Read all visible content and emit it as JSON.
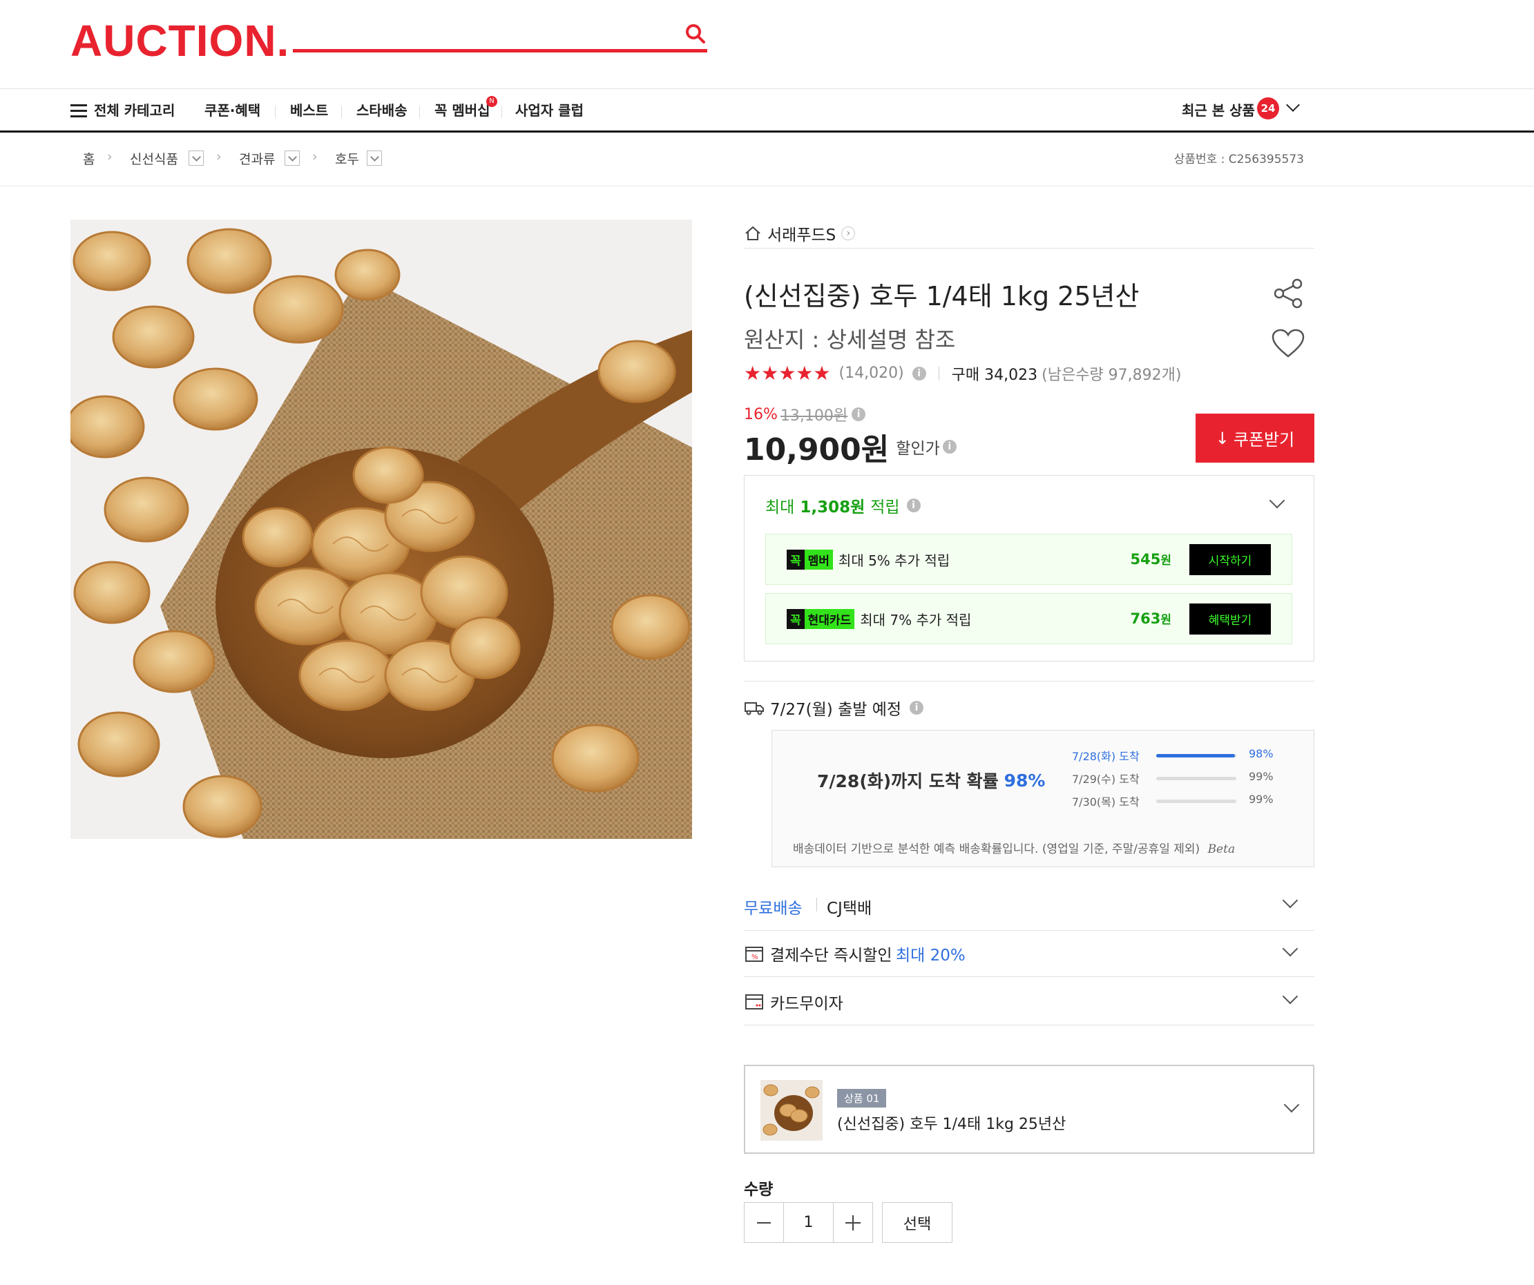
{
  "header": {
    "logo": "AUCTION.",
    "nav": [
      "전체 카테고리",
      "쿠폰·혜택",
      "베스트",
      "스타배송",
      "꼭 멤버십",
      "사업자 클럽"
    ],
    "recent_label": "최근 본 상품",
    "recent_count": "24"
  },
  "breadcrumb": {
    "items": [
      "홈",
      "신선식품",
      "견과류",
      "호두"
    ],
    "separator": "›",
    "product_no": "상품번호 : C256395573"
  },
  "product": {
    "seller": "서래푸드S",
    "title": "(신선집중) 호두 1/4태 1kg 25년산",
    "origin": "원산지 : 상세설명 참조",
    "rating": 4.5,
    "stars": "★★★★★",
    "review_count": "(14,020)",
    "purchase": "구매 34,023",
    "remaining": "(남은수량 97,892개)",
    "discount_rate": "16%",
    "original_price": "13,100원",
    "price": "10,900원",
    "price_label": "할인가",
    "coupon_button": "쿠폰받기"
  },
  "points": {
    "prefix": "최대",
    "amount": "1,308원",
    "suffix": "적립",
    "benefits": [
      {
        "badge1": "꼭",
        "badge2": "멤버",
        "text": "최대 5% 추가 적립",
        "value": "545",
        "unit": "원",
        "button": "시작하기"
      },
      {
        "badge1": "꼭",
        "badge2": "현대카드",
        "text": "최대 7% 추가 적립",
        "value": "763",
        "unit": "원",
        "button": "혜택받기"
      }
    ]
  },
  "delivery": {
    "departure": "7/27(월) 출발 예정",
    "headline": "7/28(화)까지 도착 확률",
    "headline_pct": "98%",
    "rows": [
      {
        "date": "7/28(화) 도착",
        "pct": "98%",
        "fill": 0.98,
        "active": true
      },
      {
        "date": "7/29(수) 도착",
        "pct": "99%",
        "fill": 0.0,
        "active": false
      },
      {
        "date": "7/30(목) 도착",
        "pct": "99%",
        "fill": 0.0,
        "active": false
      }
    ],
    "note": "배송데이터 기반으로 분석한 예측 배송확률입니다. (영업일 기준, 주말/공휴일 제외)",
    "beta": "Beta"
  },
  "accordion": {
    "shipping_fee": "무료배송",
    "carrier": "CJ택배",
    "payment": "결제수단 즉시할인",
    "payment_highlight": "최대 20%",
    "installment": "카드무이자"
  },
  "option": {
    "tag": "상품 01",
    "name": "(신선집중) 호두 1/4태 1kg 25년산"
  },
  "quantity": {
    "label": "수량",
    "value": "1",
    "select": "선택"
  },
  "colors": {
    "brand": "#e8232f",
    "green": "#16a012",
    "blue": "#2e6fde"
  }
}
